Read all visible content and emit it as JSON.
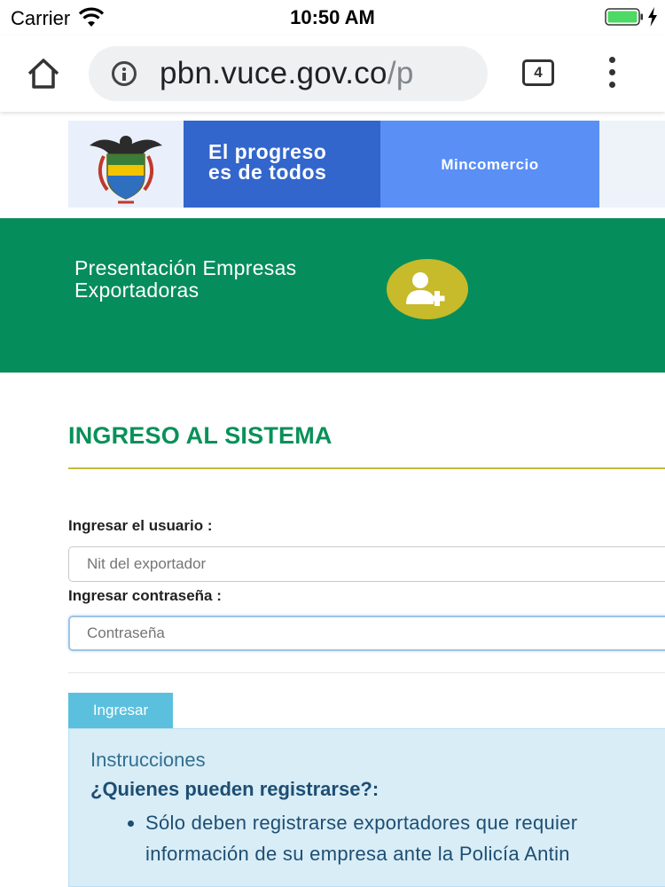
{
  "status_bar": {
    "carrier": "Carrier",
    "time": "10:50 AM"
  },
  "browser": {
    "url_main": "pbn.vuce.gov.co",
    "url_rest": "/p",
    "tab_count": "4"
  },
  "banner": {
    "progreso_line1": "El progreso",
    "progreso_line2": "es de todos",
    "ministry": "Mincomercio",
    "colors": {
      "progreso_bg": "#3366cc",
      "ministry_bg": "#5a8ff5"
    }
  },
  "hero": {
    "title_line1": "Presentación Empresas",
    "title_line2": "Exportadoras",
    "button_icon": "add-user-icon",
    "colors": {
      "bg": "#068d5c",
      "button": "#c7ba2b"
    }
  },
  "login": {
    "title": "INGRESO AL SISTEMA",
    "user_label": "Ingresar el usuario :",
    "user_placeholder": "Nit del exportador",
    "password_label": "Ingresar contraseña :",
    "password_placeholder": "Contraseña",
    "submit_label": "Ingresar"
  },
  "instructions": {
    "title": "Instrucciones",
    "subtitle": "¿Quienes pueden registrarse?:",
    "bullet_line1": "Sólo deben registrarse exportadores que requier",
    "bullet_line2": "información de su empresa ante la Policía Antin"
  }
}
